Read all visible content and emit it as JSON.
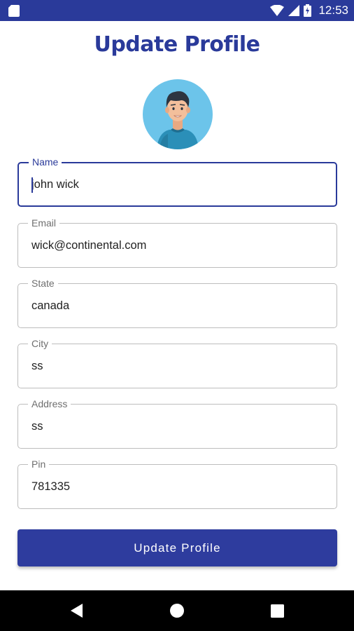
{
  "status_bar": {
    "time": "12:53",
    "icons": [
      "sd-card-icon",
      "wifi-icon",
      "signal-icon",
      "battery-charging-icon"
    ]
  },
  "page": {
    "title": "Update Profile"
  },
  "form": {
    "name": {
      "label": "Name",
      "value": "john wick"
    },
    "email": {
      "label": "Email",
      "value": "wick@continental.com"
    },
    "state": {
      "label": "State",
      "value": "canada"
    },
    "city": {
      "label": "City",
      "value": "ss"
    },
    "address": {
      "label": "Address",
      "value": "ss"
    },
    "pin": {
      "label": "Pin",
      "value": "781335"
    },
    "submit_label": "Update Profile"
  },
  "nav_bar": {
    "icons": [
      "back-icon",
      "home-icon",
      "recents-icon"
    ]
  },
  "colors": {
    "primary": "#2a3a9a",
    "status_bar": "#2a3a9a",
    "field_border": "#bdbdbd",
    "avatar_bg": "#6cc4ea"
  }
}
